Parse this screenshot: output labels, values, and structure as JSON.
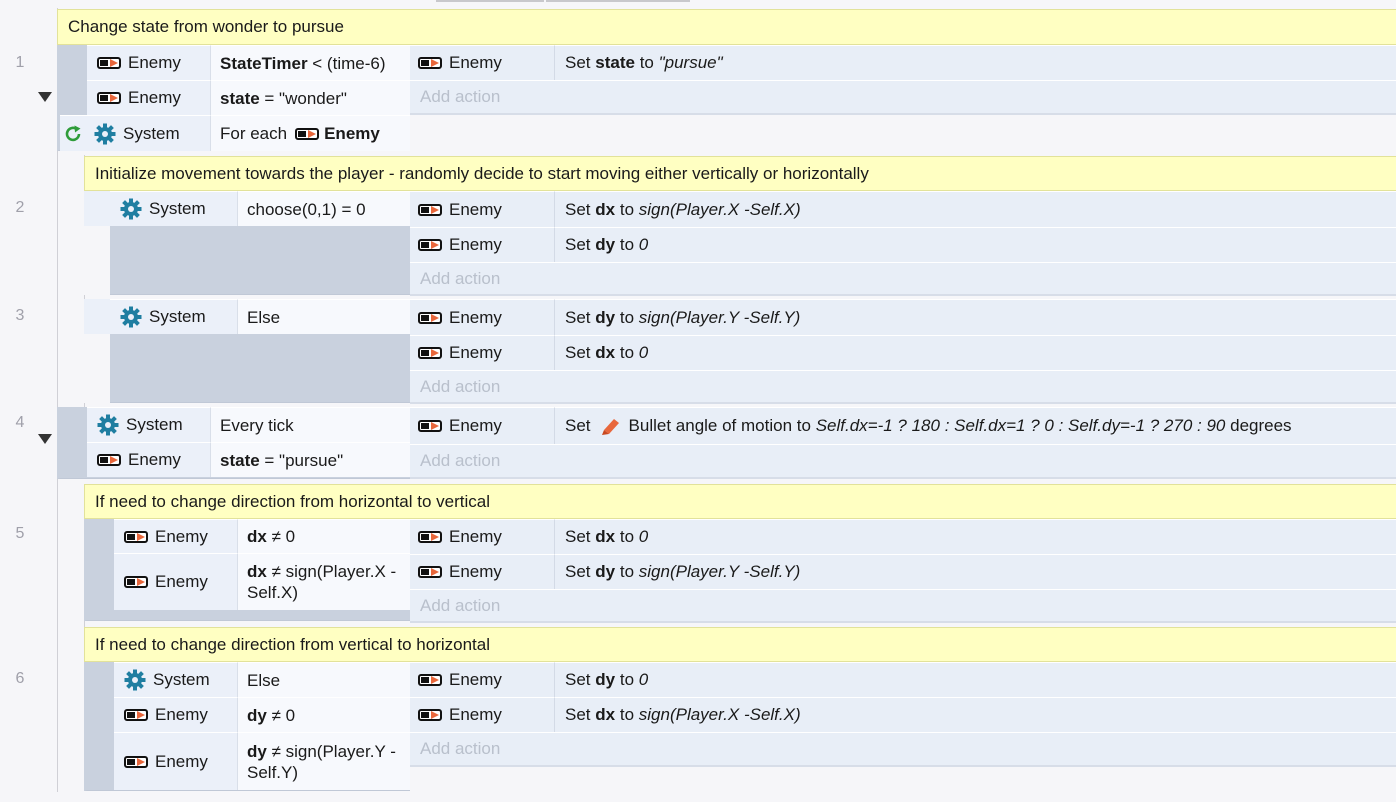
{
  "objects": {
    "enemy": "Enemy",
    "system": "System"
  },
  "words": {
    "set": "Set",
    "to": "to",
    "degrees": "degrees",
    "for_each": "For each"
  },
  "add_action": "Add action",
  "events": [
    {
      "number": "1",
      "comment": "Change state from wonder to pursue",
      "conditions": [
        {
          "object": "Enemy",
          "bold": "StateTimer",
          "rest": " < (time-6)"
        },
        {
          "object": "Enemy",
          "bold": "state",
          "rest": " = \"wonder\""
        },
        {
          "object": "System",
          "plain": "For each",
          "param_object": "Enemy"
        }
      ],
      "actions": [
        {
          "object": "Enemy",
          "var": "state",
          "value": "\"pursue\""
        }
      ]
    },
    {
      "number": "2",
      "comment": "Initialize movement towards the player - randomly decide to start moving either vertically or horizontally",
      "conditions": [
        {
          "object": "System",
          "plain": "choose(0,1) = 0"
        }
      ],
      "actions": [
        {
          "object": "Enemy",
          "var": "dx",
          "value": "sign(Player.X -Self.X)"
        },
        {
          "object": "Enemy",
          "var": "dy",
          "value": "0"
        }
      ]
    },
    {
      "number": "3",
      "conditions": [
        {
          "object": "System",
          "plain": "Else"
        }
      ],
      "actions": [
        {
          "object": "Enemy",
          "var": "dy",
          "value": "sign(Player.Y -Self.Y)"
        },
        {
          "object": "Enemy",
          "var": "dx",
          "value": "0"
        }
      ]
    },
    {
      "number": "4",
      "conditions": [
        {
          "object": "System",
          "plain": "Every tick"
        },
        {
          "object": "Enemy",
          "bold": "state",
          "rest": " = \"pursue\""
        }
      ],
      "actions": [
        {
          "object": "Enemy",
          "behavior": "Bullet angle of motion",
          "value": "Self.dx=-1 ? 180 : Self.dx=1 ? 0 : Self.dy=-1 ? 270 : 90"
        }
      ]
    },
    {
      "number": "5",
      "comment": "If need to change direction from horizontal to vertical",
      "conditions": [
        {
          "object": "Enemy",
          "bold": "dx",
          "rest": " ≠ 0"
        },
        {
          "object": "Enemy",
          "bold": "dx",
          "rest": " ≠ sign(Player.X -Self.X)"
        }
      ],
      "actions": [
        {
          "object": "Enemy",
          "var": "dx",
          "value": "0"
        },
        {
          "object": "Enemy",
          "var": "dy",
          "value": "sign(Player.Y -Self.Y)"
        }
      ]
    },
    {
      "number": "6",
      "comment": "If need to change direction from vertical to horizontal",
      "conditions": [
        {
          "object": "System",
          "plain": "Else"
        },
        {
          "object": "Enemy",
          "bold": "dy",
          "rest": " ≠ 0"
        },
        {
          "object": "Enemy",
          "bold": "dy",
          "rest": " ≠ sign(Player.Y -Self.Y)"
        }
      ],
      "actions": [
        {
          "object": "Enemy",
          "var": "dy",
          "value": "0"
        },
        {
          "object": "Enemy",
          "var": "dx",
          "value": "sign(Player.X -Self.X)"
        }
      ]
    }
  ],
  "colors": {
    "comment_bg": "#ffffc2",
    "condition_bg": "#ebf0f9",
    "action_bg": "#e8eef7",
    "gear": "#1f7ea1",
    "loop": "#2e9c3a",
    "bullet_icon": "#e8673c"
  },
  "icons": [
    "enemy-sprite-icon",
    "gear-icon",
    "loop-icon",
    "bullet-behavior-icon",
    "collapse-arrow-icon"
  ]
}
